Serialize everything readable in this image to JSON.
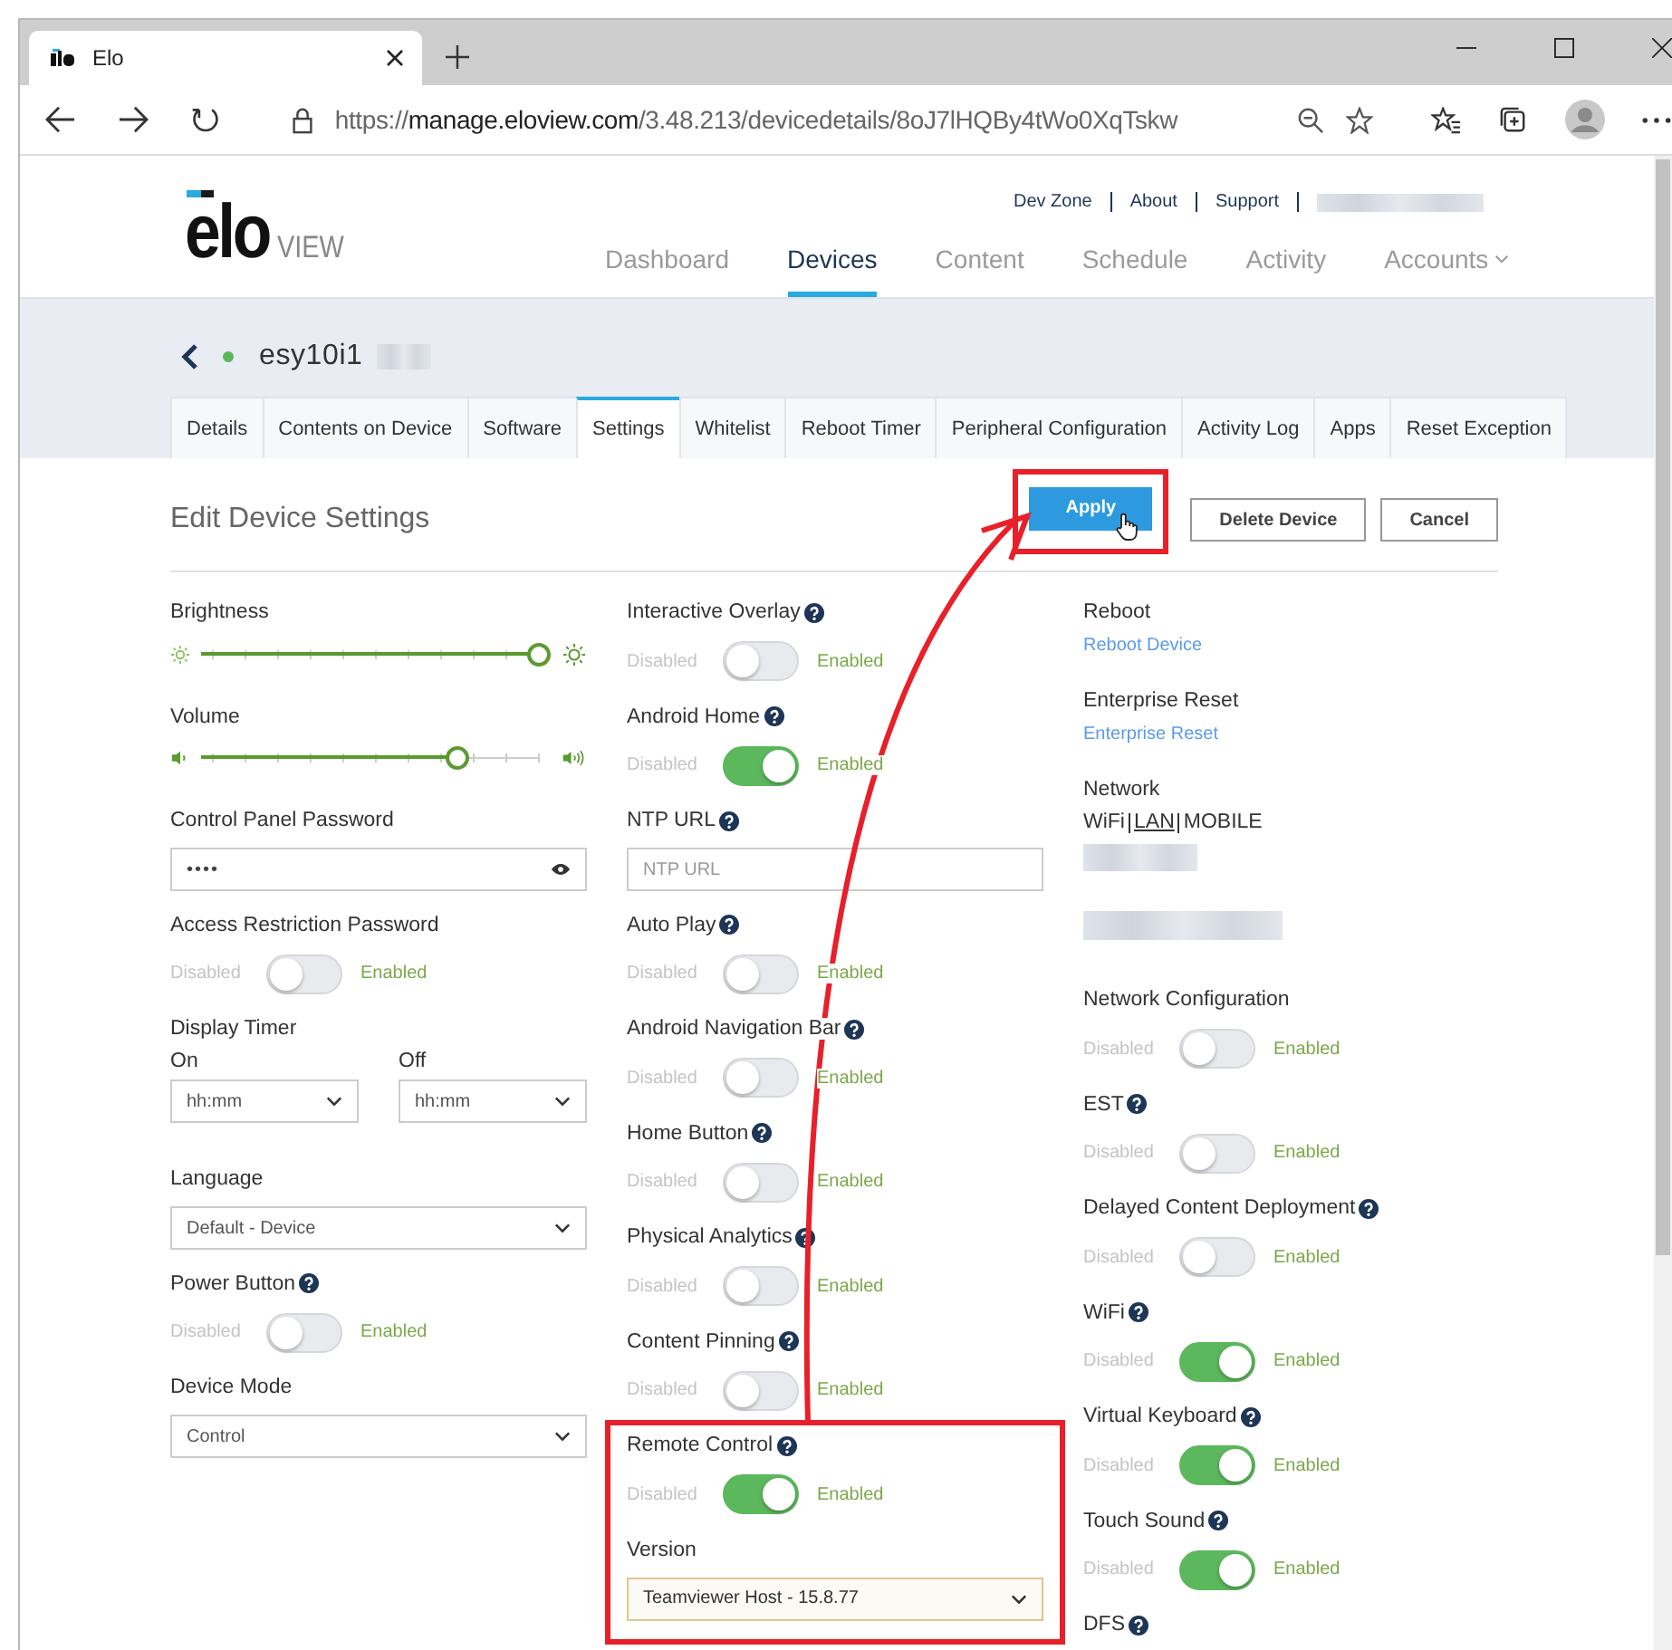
{
  "browser": {
    "tab_title": "Elo",
    "url": {
      "scheme": "https://",
      "domain": "manage.eloview.com",
      "path": "/3.48.213/devicedetails/8oJ7lHQBy4tWo0XqTskw"
    }
  },
  "header": {
    "logo": {
      "wordmark": "elo",
      "subtitle": "VIEW"
    },
    "top_links": [
      "Dev Zone",
      "About",
      "Support"
    ],
    "nav": [
      {
        "label": "Dashboard",
        "selected": false,
        "dropdown": false
      },
      {
        "label": "Devices",
        "selected": true,
        "dropdown": false
      },
      {
        "label": "Content",
        "selected": false,
        "dropdown": false
      },
      {
        "label": "Schedule",
        "selected": false,
        "dropdown": false
      },
      {
        "label": "Activity",
        "selected": false,
        "dropdown": false
      },
      {
        "label": "Accounts",
        "selected": false,
        "dropdown": true
      }
    ]
  },
  "device": {
    "name": "esy10i1",
    "online": true
  },
  "tabs": [
    {
      "label": "Details",
      "selected": false
    },
    {
      "label": "Contents on Device",
      "selected": false
    },
    {
      "label": "Software",
      "selected": false
    },
    {
      "label": "Settings",
      "selected": true
    },
    {
      "label": "Whitelist",
      "selected": false
    },
    {
      "label": "Reboot Timer",
      "selected": false
    },
    {
      "label": "Peripheral Configuration",
      "selected": false
    },
    {
      "label": "Activity Log",
      "selected": false
    },
    {
      "label": "Apps",
      "selected": false
    },
    {
      "label": "Reset Exception",
      "selected": false
    }
  ],
  "form": {
    "title": "Edit Device Settings",
    "buttons": [
      {
        "label": "Apply",
        "kind": "primary",
        "highlighted": true
      },
      {
        "label": "Delete Device",
        "kind": "secondary",
        "highlighted": false
      },
      {
        "label": "Cancel",
        "kind": "secondary",
        "highlighted": false
      }
    ],
    "columns": [
      {
        "items": [
          {
            "kind": "slider",
            "label": "Brightness",
            "level": 1.0
          },
          {
            "kind": "slider",
            "label": "Volume",
            "level": 0.75
          },
          {
            "kind": "password",
            "label": "Control Panel Password",
            "value": "••••"
          },
          {
            "kind": "toggle",
            "label": "Access Restriction Password",
            "help": false,
            "on": false,
            "off_label": "Disabled",
            "on_label": "Enabled"
          },
          {
            "kind": "timer",
            "label": "Display Timer",
            "fields": [
              {
                "label": "On",
                "value": "hh:mm"
              },
              {
                "label": "Off",
                "value": "hh:mm"
              }
            ]
          },
          {
            "kind": "select",
            "label": "Language",
            "help": false,
            "value": "Default - Device"
          },
          {
            "kind": "toggle",
            "label": "Power Button",
            "help": true,
            "on": false,
            "off_label": "Disabled",
            "on_label": "Enabled"
          },
          {
            "kind": "select",
            "label": "Device Mode",
            "help": false,
            "value": "Control"
          }
        ]
      },
      {
        "items": [
          {
            "kind": "toggle",
            "label": "Interactive Overlay",
            "help": true,
            "on": false,
            "off_label": "Disabled",
            "on_label": "Enabled"
          },
          {
            "kind": "toggle",
            "label": "Android Home",
            "help": true,
            "on": true,
            "off_label": "Disabled",
            "on_label": "Enabled"
          },
          {
            "kind": "text",
            "label": "NTP URL",
            "help": true,
            "placeholder": "NTP URL"
          },
          {
            "kind": "toggle",
            "label": "Auto Play",
            "help": true,
            "on": false,
            "off_label": "Disabled",
            "on_label": "Enabled"
          },
          {
            "kind": "toggle",
            "label": "Android Navigation Bar",
            "help": true,
            "on": false,
            "off_label": "Disabled",
            "on_label": "Enabled"
          },
          {
            "kind": "toggle",
            "label": "Home Button",
            "help": true,
            "on": false,
            "off_label": "Disabled",
            "on_label": "Enabled"
          },
          {
            "kind": "toggle",
            "label": "Physical Analytics",
            "help": true,
            "on": false,
            "off_label": "Disabled",
            "on_label": "Enabled"
          },
          {
            "kind": "toggle",
            "label": "Content Pinning",
            "help": true,
            "on": false,
            "off_label": "Disabled",
            "on_label": "Enabled"
          }
        ],
        "highlighted_items": [
          {
            "kind": "toggle",
            "label": "Remote Control",
            "help": true,
            "on": true,
            "off_label": "Disabled",
            "on_label": "Enabled"
          },
          {
            "kind": "select",
            "label": "Version",
            "help": false,
            "value": "Teamviewer Host - 15.8.77"
          }
        ]
      },
      {
        "items": [
          {
            "kind": "link",
            "label": "Reboot",
            "link": "Reboot Device"
          },
          {
            "kind": "link",
            "label": "Enterprise Reset",
            "link": "Enterprise Reset"
          },
          {
            "kind": "network",
            "label": "Network",
            "options": [
              {
                "label": "WiFi",
                "selected": false
              },
              {
                "label": "LAN",
                "selected": true
              },
              {
                "label": "MOBILE",
                "selected": false
              }
            ]
          },
          {
            "kind": "toggle",
            "label": "Network Configuration",
            "help": false,
            "on": false,
            "off_label": "Disabled",
            "on_label": "Enabled"
          },
          {
            "kind": "toggle",
            "label": "EST",
            "help": true,
            "on": false,
            "off_label": "Disabled",
            "on_label": "Enabled"
          },
          {
            "kind": "toggle",
            "label": "Delayed Content Deployment",
            "help": true,
            "on": false,
            "off_label": "Disabled",
            "on_label": "Enabled"
          },
          {
            "kind": "toggle",
            "label": "WiFi",
            "help": true,
            "on": true,
            "off_label": "Disabled",
            "on_label": "Enabled"
          },
          {
            "kind": "toggle",
            "label": "Virtual Keyboard",
            "help": true,
            "on": true,
            "off_label": "Disabled",
            "on_label": "Enabled"
          },
          {
            "kind": "toggle",
            "label": "Touch Sound",
            "help": true,
            "on": true,
            "off_label": "Disabled",
            "on_label": "Enabled"
          },
          {
            "kind": "heading",
            "label": "DFS",
            "help": true
          }
        ]
      }
    ]
  }
}
